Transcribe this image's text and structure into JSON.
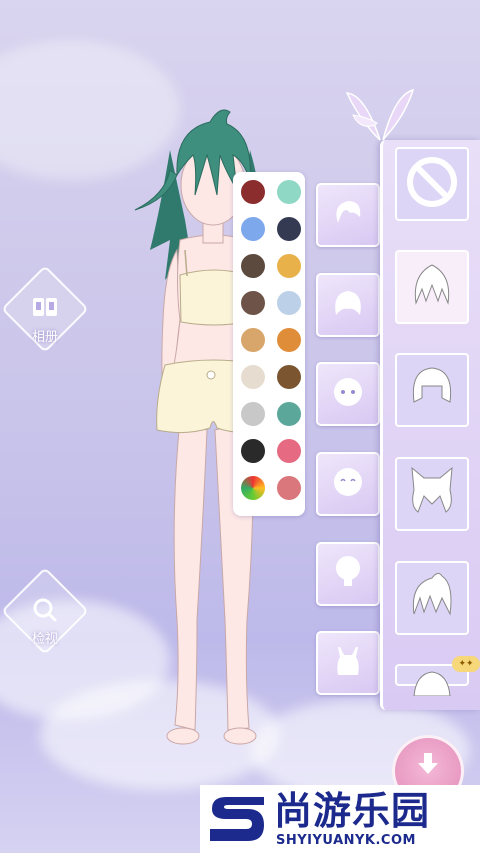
{
  "left_buttons": {
    "album": {
      "label": "相册",
      "icon": "album-icon"
    },
    "preview": {
      "label": "检视",
      "icon": "magnifier-icon"
    }
  },
  "palette": {
    "colors": [
      "#8b2d2c",
      "#8fd8c5",
      "#7ea8ec",
      "#333a52",
      "#5d4a3e",
      "#e8b14a",
      "#6e5448",
      "#bcd0e8",
      "#d8a56a",
      "#e08d3a",
      "#e6ddd0",
      "#7a5530",
      "#c8c8c8",
      "#5ba89a",
      "#2a2a2a",
      "#e66a82",
      "rainbow",
      "#d9777d"
    ]
  },
  "categories": [
    {
      "name": "hair",
      "icon": "hair-category-icon"
    },
    {
      "name": "back-hair",
      "icon": "back-hair-category-icon"
    },
    {
      "name": "face",
      "icon": "face-category-icon"
    },
    {
      "name": "expression",
      "icon": "expression-category-icon"
    },
    {
      "name": "head",
      "icon": "head-category-icon"
    },
    {
      "name": "top",
      "icon": "top-category-icon"
    }
  ],
  "hair_items": [
    {
      "icon": "none-icon",
      "selected": false
    },
    {
      "icon": "hairstyle-spiky-icon",
      "selected": true
    },
    {
      "icon": "hairstyle-bob-icon",
      "selected": false
    },
    {
      "icon": "hairstyle-cat-ears-icon",
      "selected": false
    },
    {
      "icon": "hairstyle-messy-icon",
      "selected": false
    },
    {
      "icon": "hairstyle-partial-icon",
      "selected": false
    }
  ],
  "badge": {
    "label": "✦✦"
  },
  "save_button": {
    "icon": "download-icon"
  },
  "watermark": {
    "title": "尚游乐园",
    "url": "SHYIYUANYK.COM"
  },
  "colors": {
    "hair": "#3f8f7f",
    "outfit": "#fbf4d8",
    "skin": "#fde8e6",
    "accent_purple": "#c9b8f0",
    "brand_blue": "#1b2a8c"
  }
}
